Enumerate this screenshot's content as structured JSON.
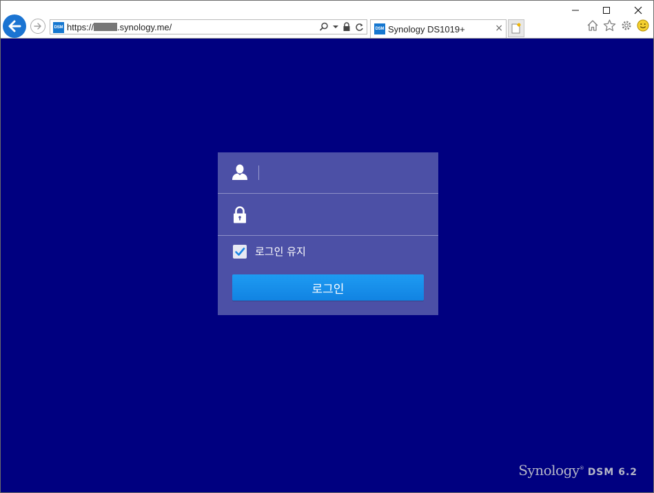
{
  "browser": {
    "url_prefix": "https://",
    "url_suffix": ".synology.me/",
    "favicon_text": "DSM",
    "tab_title": "Synology DS1019+",
    "tab_close": "×"
  },
  "login": {
    "remember_label": "로그인 유지",
    "remember_checked": true,
    "login_button": "로그인"
  },
  "branding": {
    "synology": "Synology",
    "trademark": "®",
    "dsm": "DSM 6.2"
  },
  "icons": {
    "back": "back-arrow-icon",
    "forward": "forward-arrow-icon",
    "search": "search-icon",
    "dropdown": "dropdown-arrow-icon",
    "lock": "lock-icon",
    "refresh": "refresh-icon",
    "new_tab": "new-tab-icon",
    "home": "home-icon",
    "favorites": "star-icon",
    "settings": "gear-icon",
    "feedback": "smiley-icon",
    "user": "user-icon",
    "password": "padlock-icon",
    "check": "checkmark-icon"
  },
  "colors": {
    "page_background": "#000080",
    "dialog_background": "#4c50a6",
    "button_blue": "#1890ea",
    "browser_back": "#1b74d2"
  }
}
